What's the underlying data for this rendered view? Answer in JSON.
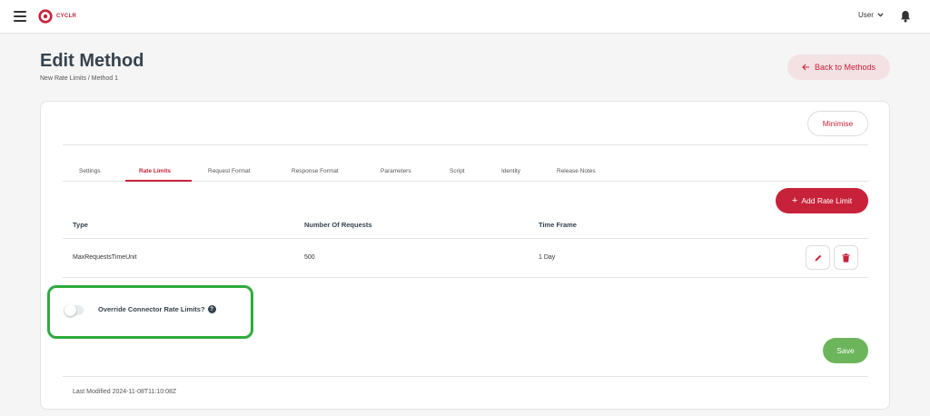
{
  "app": {
    "logo_text": "CYCLR",
    "brand_color": "#c8223a"
  },
  "topbar": {
    "user_label": "User"
  },
  "header": {
    "title": "Edit Method",
    "breadcrumb": "New Rate Limits / Method 1",
    "back_label": "Back to Methods"
  },
  "card": {
    "minimise_label": "Minimise",
    "tabs": [
      {
        "label": "Settings"
      },
      {
        "label": "Rate Limits",
        "active": true
      },
      {
        "label": "Request Format"
      },
      {
        "label": "Response Format"
      },
      {
        "label": "Parameters"
      },
      {
        "label": "Script"
      },
      {
        "label": "Identity"
      },
      {
        "label": "Release Notes"
      }
    ],
    "add_label": "Add Rate Limit",
    "table": {
      "headers": [
        "Type",
        "Number Of Requests",
        "Time Frame"
      ],
      "rows": [
        [
          "MaxRequestsTimeUnit",
          "500",
          "1 Day"
        ]
      ]
    },
    "override": {
      "label": "Override Connector Rate Limits?",
      "enabled": false
    },
    "save_label": "Save",
    "last_modified": "Last Modified 2024-11-08T11:10:08Z"
  },
  "colors": {
    "accent": "#c8223a",
    "save": "#6cb55a",
    "highlight": "#2faa3f",
    "title": "#36434f"
  },
  "icons": [
    "hamburger-icon",
    "cyclr-logo-icon",
    "chevron-down-icon",
    "bell-icon",
    "arrow-left-icon",
    "plus-icon",
    "pencil-icon",
    "trash-icon",
    "question-icon"
  ]
}
